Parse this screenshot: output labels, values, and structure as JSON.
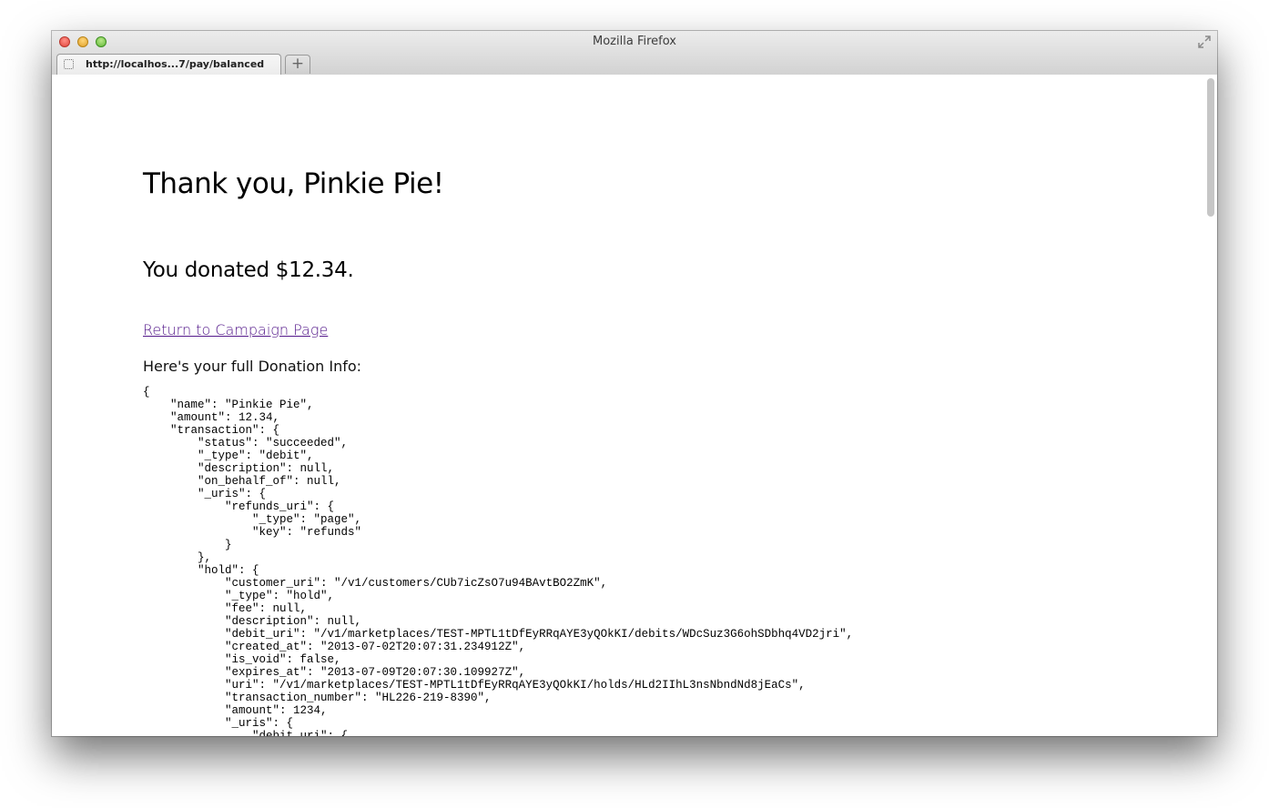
{
  "window": {
    "title": "Mozilla Firefox"
  },
  "tabs": [
    {
      "label": "http://localhos...7/pay/balanced"
    }
  ],
  "new_tab_label": "+",
  "page": {
    "heading": "Thank you, Pinkie Pie!",
    "amount_text": "You donated $12.34.",
    "return_link": "Return to Campaign Page",
    "info_label": "Here's your full Donation Info:",
    "json_dump": "{\n    \"name\": \"Pinkie Pie\",\n    \"amount\": 12.34,\n    \"transaction\": {\n        \"status\": \"succeeded\",\n        \"_type\": \"debit\",\n        \"description\": null,\n        \"on_behalf_of\": null,\n        \"_uris\": {\n            \"refunds_uri\": {\n                \"_type\": \"page\",\n                \"key\": \"refunds\"\n            }\n        },\n        \"hold\": {\n            \"customer_uri\": \"/v1/customers/CUb7icZsO7u94BAvtBO2ZmK\",\n            \"_type\": \"hold\",\n            \"fee\": null,\n            \"description\": null,\n            \"debit_uri\": \"/v1/marketplaces/TEST-MPTL1tDfEyRRqAYE3yQOkKI/debits/WDcSuz3G6ohSDbhq4VD2jri\",\n            \"created_at\": \"2013-07-02T20:07:31.234912Z\",\n            \"is_void\": false,\n            \"expires_at\": \"2013-07-09T20:07:30.109927Z\",\n            \"uri\": \"/v1/marketplaces/TEST-MPTL1tDfEyRRqAYE3yQOkKI/holds/HLd2IIhL3nsNbndNd8jEaCs\",\n            \"transaction_number\": \"HL226-219-8390\",\n            \"amount\": 1234,\n            \"_uris\": {\n                \"debit_uri\": {"
  },
  "colors": {
    "link_visited": "#551a8b",
    "close_button": "#e2463c",
    "minimize_button": "#e0a12a",
    "zoom_button": "#61b737"
  },
  "icons": {
    "fullscreen": "fullscreen-arrows-icon",
    "favicon": "blank-page-icon"
  }
}
